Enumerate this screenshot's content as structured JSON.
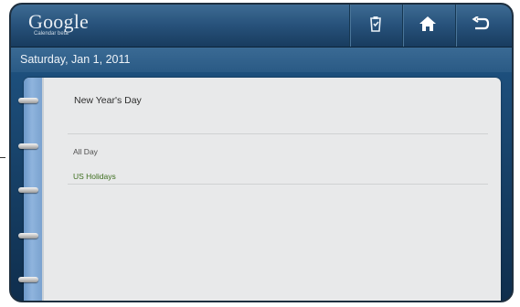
{
  "header": {
    "logo_text": "Google",
    "logo_sub": "Calendar beta",
    "buttons": [
      {
        "name": "bookmark-button",
        "icon": "clipboard-icon"
      },
      {
        "name": "home-button",
        "icon": "home-icon"
      },
      {
        "name": "back-button",
        "icon": "return-arrow-icon"
      }
    ]
  },
  "date_bar": {
    "date": "Saturday, Jan 1, 2011"
  },
  "event": {
    "title": "New Year's Day",
    "time": "All Day",
    "calendar": "US Holidays"
  },
  "colors": {
    "header": "#2a5780",
    "date_bar": "#336392",
    "page": "#e8e9ea",
    "calendar_text": "#3d6e1e"
  }
}
